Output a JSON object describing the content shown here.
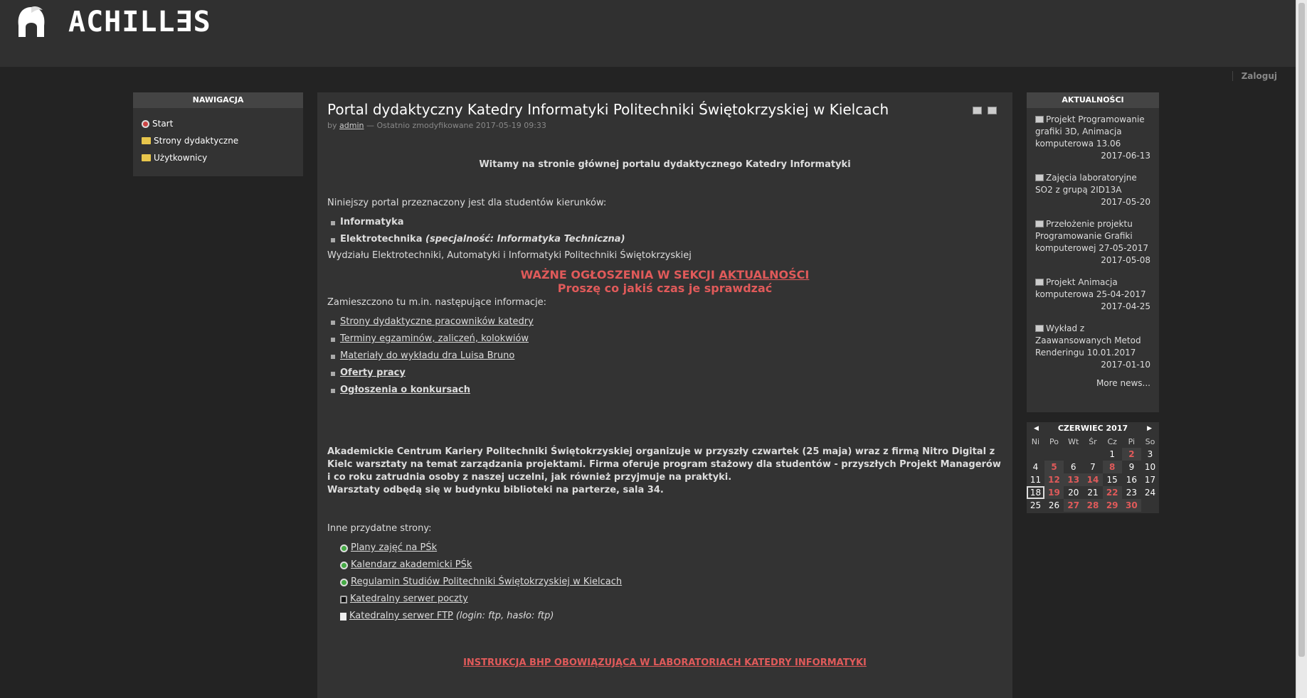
{
  "header": {
    "logo_text": "ACHILL∃S",
    "login": "Zaloguj"
  },
  "nav": {
    "title": "NAWIGACJA",
    "items": [
      {
        "label": "Start",
        "icon": "start-icon"
      },
      {
        "label": "Strony dydaktyczne",
        "icon": "folder-icon"
      },
      {
        "label": "Użytkownicy",
        "icon": "folder-icon"
      }
    ]
  },
  "main": {
    "title": "Portal dydaktyczny Katedry Informatyki Politechniki Świętokrzyskiej w Kielcach",
    "meta_by": "by",
    "meta_author": "admin",
    "meta_modified": "— Ostatnio zmodyfikowane 2017-05-19 09:33",
    "welcome": "Witamy na stronie głównej portalu dydaktycznego Katedry Informatyki",
    "intro": "Niniejszy portal przeznaczony jest dla studentów kierunków:",
    "program1": "Informatyka",
    "program2": "Elektrotechnika",
    "program2_note": "(specjalność: Informatyka Techniczna)",
    "faculty": "Wydziału Elektrotechniki, Automatyki i Informatyki Politechniki Świętokrzyskiej",
    "notice_prefix": "WAŻNE OGŁOSZENIA W SEKCJI ",
    "notice_link": "AKTUALNOŚCI",
    "notice_line2": "Proszę co jakiś czas je sprawdzać",
    "info_intro": "Zamieszczono tu m.in. następujące informacje:",
    "info_links": [
      "Strony dydaktyczne pracowników katedry",
      "Terminy egzaminów, zaliczeń, kolokwiów",
      "Materiały do wykładu dra Luisa Bruno",
      "Oferty pracy",
      "Ogłoszenia o konkursach"
    ],
    "announcement": "Akademickie Centrum Kariery Politechniki Świętokrzyskiej organizuje w przyszły czwartek (25 maja) wraz z firmą Nitro Digital z Kielc warsztaty na temat zarządzania projektami. Firma oferuje program stażowy dla studentów - przyszłych Projekt Managerów i co roku zatrudnia osoby z naszej uczelni, jak również przyjmuje na praktyki.",
    "announcement2": "Warsztaty odbędą się w budynku biblioteki na parterze, sala 34.",
    "other_intro": "Inne przydatne strony:",
    "other_links": [
      {
        "label": "Plany zajęć na PŚk",
        "icon": "globe-icon"
      },
      {
        "label": "Kalendarz akademicki PŚk",
        "icon": "globe-icon"
      },
      {
        "label": "Regulamin Studiów Politechniki Świętokrzyskiej w Kielcach",
        "icon": "globe-icon"
      },
      {
        "label": "Katedralny serwer poczty",
        "icon": "lock-icon"
      },
      {
        "label": "Katedralny serwer FTP",
        "icon": "file-icon"
      }
    ],
    "ftp_note": "(login: ftp, hasło: ftp)",
    "bhp": "INSTRUKCJA BHP OBOWIĄZUJĄCA W LABORATORIACH KATEDRY INFORMATYKI"
  },
  "news": {
    "title": "AKTUALNOŚCI",
    "items": [
      {
        "title": "Projekt Programowanie grafiki 3D, Animacja komputerowa 13.06",
        "date": "2017-06-13"
      },
      {
        "title": "Zajęcia laboratoryjne SO2 z grupą 2ID13A",
        "date": "2017-05-20"
      },
      {
        "title": "Przełożenie projektu Programowanie Grafiki komputerowej 27-05-2017",
        "date": "2017-05-08"
      },
      {
        "title": "Projekt Animacja komputerowa 25-04-2017",
        "date": "2017-04-25"
      },
      {
        "title": "Wykład z Zaawansowanych Metod Renderingu 10.01.2017",
        "date": "2017-01-10"
      }
    ],
    "more": "More news..."
  },
  "calendar": {
    "month": "CZERWIEC 2017",
    "days": [
      "Ni",
      "Po",
      "Wt",
      "Śr",
      "Cz",
      "Pi",
      "So"
    ],
    "weeks": [
      [
        "",
        "",
        "",
        "",
        "1",
        "2",
        "3"
      ],
      [
        "4",
        "5",
        "6",
        "7",
        "8",
        "9",
        "10"
      ],
      [
        "11",
        "12",
        "13",
        "14",
        "15",
        "16",
        "17"
      ],
      [
        "18",
        "19",
        "20",
        "21",
        "22",
        "23",
        "24"
      ],
      [
        "25",
        "26",
        "27",
        "28",
        "29",
        "30",
        ""
      ]
    ],
    "highlighted": [
      "2",
      "5",
      "8",
      "12",
      "13",
      "14",
      "19",
      "22",
      "27",
      "28",
      "29",
      "30"
    ],
    "today": "18"
  },
  "colors": {
    "accent_red": "#e05a5a",
    "background": "#232323",
    "panel": "#333333"
  }
}
